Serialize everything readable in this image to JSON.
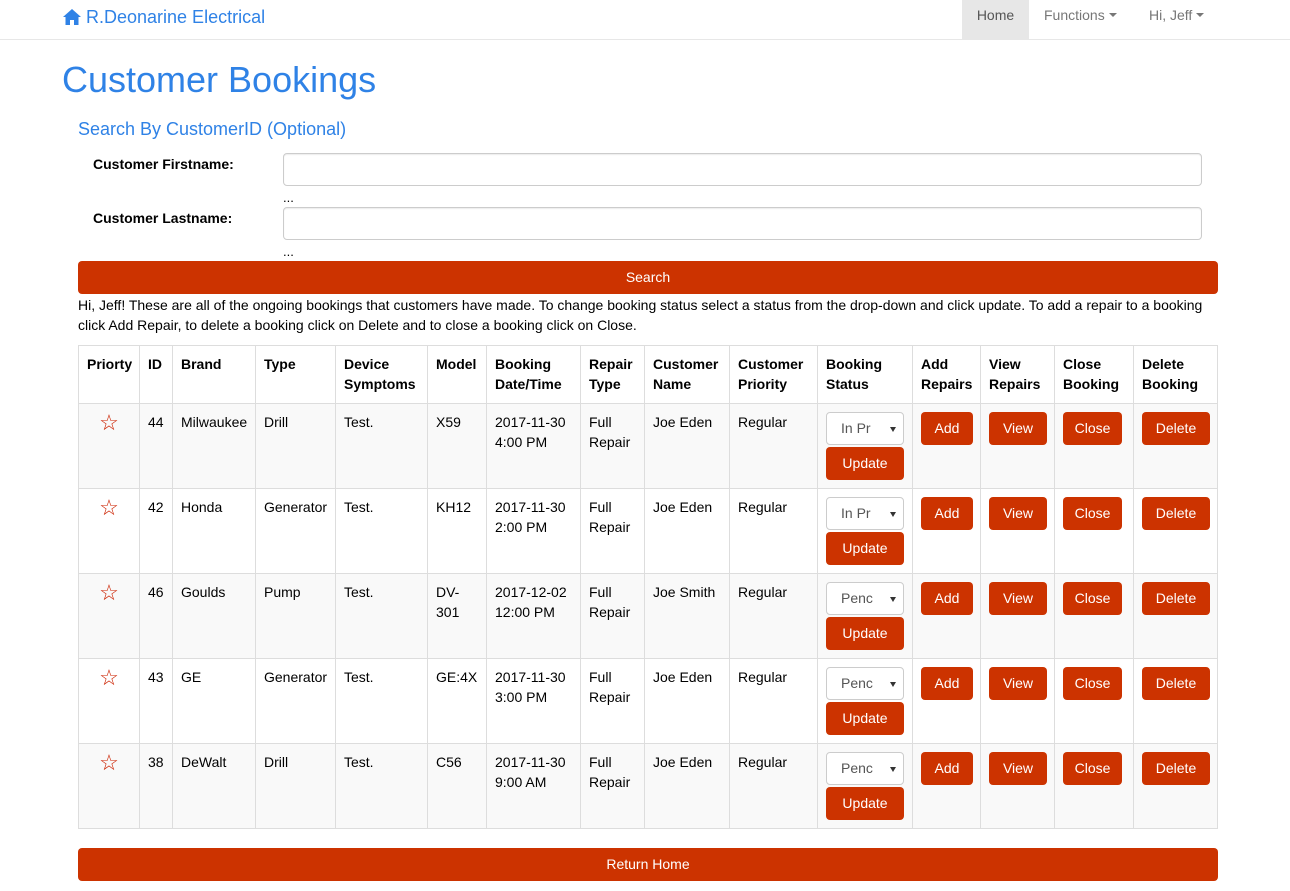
{
  "nav": {
    "brand": "R.Deonarine Electrical",
    "home": "Home",
    "functions": "Functions",
    "user": "Hi, Jeff"
  },
  "page": {
    "title": "Customer Bookings",
    "search_title": "Search By CustomerID (Optional)",
    "firstname_label": "Customer Firstname:",
    "firstname_value": "",
    "firstname_hint": "...",
    "lastname_label": "Customer Lastname:",
    "lastname_value": "",
    "lastname_hint": "...",
    "search_button": "Search",
    "info": "Hi, Jeff! These are all of the ongoing bookings that customers have made. To change booking status select a status from the drop-down and click update. To add a repair to a booking click Add Repair, to delete a booking click on Delete and to close a booking click on Close.",
    "return_button": "Return Home"
  },
  "table": {
    "headers": [
      "Priorty",
      "ID",
      "Brand",
      "Type",
      "Device Symptoms",
      "Model",
      "Booking Date/Time",
      "Repair Type",
      "Customer Name",
      "Customer Priority",
      "Booking Status",
      "Add Repairs",
      "View Repairs",
      "Close Booking",
      "Delete Booking"
    ],
    "star": "☆",
    "update_label": "Update",
    "add_label": "Add",
    "view_label": "View",
    "close_label": "Close",
    "delete_label": "Delete",
    "rows": [
      {
        "id": "44",
        "brand": "Milwaukee",
        "type": "Drill",
        "symptoms": "Test.",
        "model": "X59",
        "datetime": "2017-11-30 4:00 PM",
        "repair_type": "Full Repair",
        "customer": "Joe Eden",
        "priority": "Regular",
        "status": "In Pr"
      },
      {
        "id": "42",
        "brand": "Honda",
        "type": "Generator",
        "symptoms": "Test.",
        "model": "KH12",
        "datetime": "2017-11-30 2:00 PM",
        "repair_type": "Full Repair",
        "customer": "Joe Eden",
        "priority": "Regular",
        "status": "In Pr"
      },
      {
        "id": "46",
        "brand": "Goulds",
        "type": "Pump",
        "symptoms": "Test.",
        "model": "DV-301",
        "datetime": "2017-12-02 12:00 PM",
        "repair_type": "Full Repair",
        "customer": "Joe Smith",
        "priority": "Regular",
        "status": "Penc"
      },
      {
        "id": "43",
        "brand": "GE",
        "type": "Generator",
        "symptoms": "Test.",
        "model": "GE:4X",
        "datetime": "2017-11-30 3:00 PM",
        "repair_type": "Full Repair",
        "customer": "Joe Eden",
        "priority": "Regular",
        "status": "Penc"
      },
      {
        "id": "38",
        "brand": "DeWalt",
        "type": "Drill",
        "symptoms": "Test.",
        "model": "C56",
        "datetime": "2017-11-30 9:00 AM",
        "repair_type": "Full Repair",
        "customer": "Joe Eden",
        "priority": "Regular",
        "status": "Penc"
      }
    ]
  },
  "colors": {
    "brand_blue": "#2f82e6",
    "accent_red": "#cc3300",
    "star_red": "#cc2200"
  }
}
